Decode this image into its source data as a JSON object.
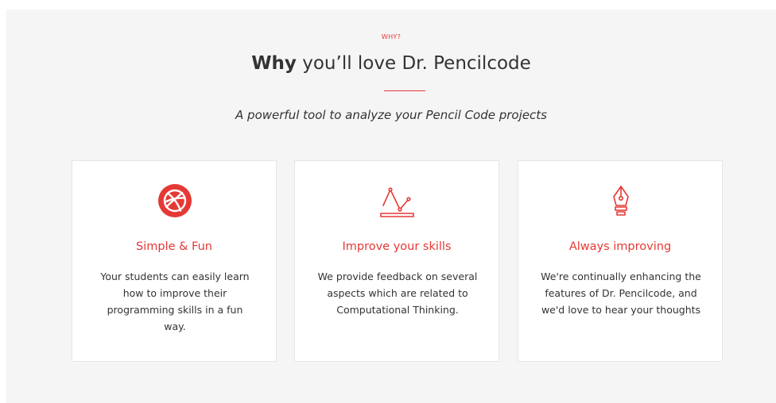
{
  "header": {
    "eyebrow": "WHY?",
    "title_bold": "Why",
    "title_rest": " you’ll love Dr. Pencilcode",
    "subtitle": "A powerful tool to analyze your Pencil Code projects"
  },
  "features": [
    {
      "icon": "dribbble-icon",
      "title": "Simple & Fun",
      "text": "Your students can easily learn how to improve their programming skills in a fun way."
    },
    {
      "icon": "line-chart-icon",
      "title": "Improve your skills",
      "text": "We provide feedback on several aspects which are related to Computational Thinking."
    },
    {
      "icon": "pen-nib-icon",
      "title": "Always improving",
      "text": "We're continually enhancing the features of Dr. Pencilcode, and we'd love to hear your thoughts"
    }
  ],
  "colors": {
    "accent": "#e53935",
    "text": "#333333",
    "section_bg": "#f5f5f5"
  }
}
